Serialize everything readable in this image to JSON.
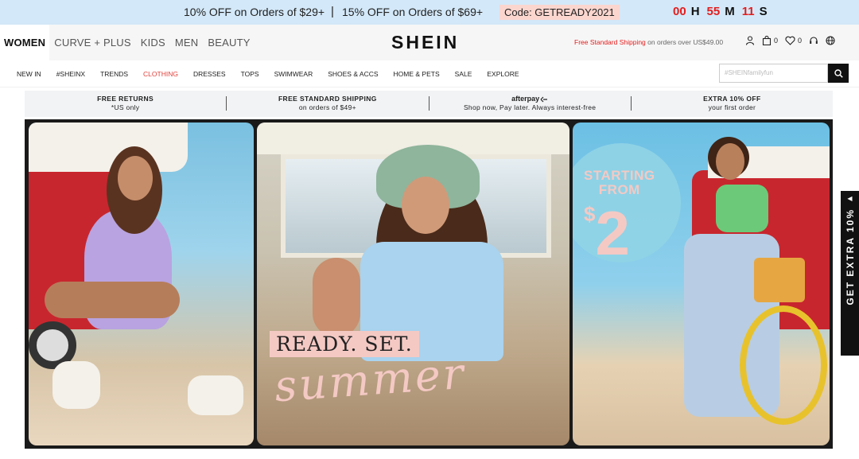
{
  "promo": {
    "offer1": "10% OFF on Orders of $29+",
    "separator": "|",
    "offer2": "15% OFF on Orders of $69+",
    "code": "Code: GETREADY2021",
    "countdown": [
      {
        "value": "00",
        "unit": "H"
      },
      {
        "value": "55",
        "unit": "M"
      },
      {
        "value": "11",
        "unit": "S"
      }
    ]
  },
  "header": {
    "categories": [
      "WOMEN",
      "CURVE + PLUS",
      "KIDS",
      "MEN",
      "BEAUTY"
    ],
    "logo": "SHEIN",
    "shipping_highlight": "Free Standard Shipping",
    "shipping_rest": "on orders over US$49.00",
    "bag_count": "0",
    "wishlist_count": "0"
  },
  "nav": {
    "items": [
      "NEW IN",
      "#SHEINX",
      "TRENDS",
      "CLOTHING",
      "DRESSES",
      "TOPS",
      "SWIMWEAR",
      "SHOES & ACCS",
      "HOME & PETS",
      "SALE",
      "EXPLORE"
    ],
    "highlight_color": "#e2413a",
    "search_placeholder": "#SHEINfamilyfun"
  },
  "benefits": [
    {
      "title": "FREE RETURNS",
      "desc": "*US only"
    },
    {
      "title": "FREE STANDARD SHIPPING",
      "desc": "on orders of $49+"
    },
    {
      "title": "afterpay",
      "desc": "Shop now, Pay later. Always interest-free"
    },
    {
      "title": "EXTRA 10% OFF",
      "desc": "your first order"
    }
  ],
  "banner": {
    "ready": "READY. SET.",
    "summer": "summer",
    "starting": "STARTING",
    "from": "FROM",
    "currency": "$",
    "price": "2"
  },
  "sidetab": {
    "arrow": "◀",
    "label": "GET EXTRA 10%"
  },
  "colors": {
    "promo_bg": "#d3e8f8",
    "countdown": "#e41d1d",
    "accent_pink": "#f4c9c4"
  }
}
